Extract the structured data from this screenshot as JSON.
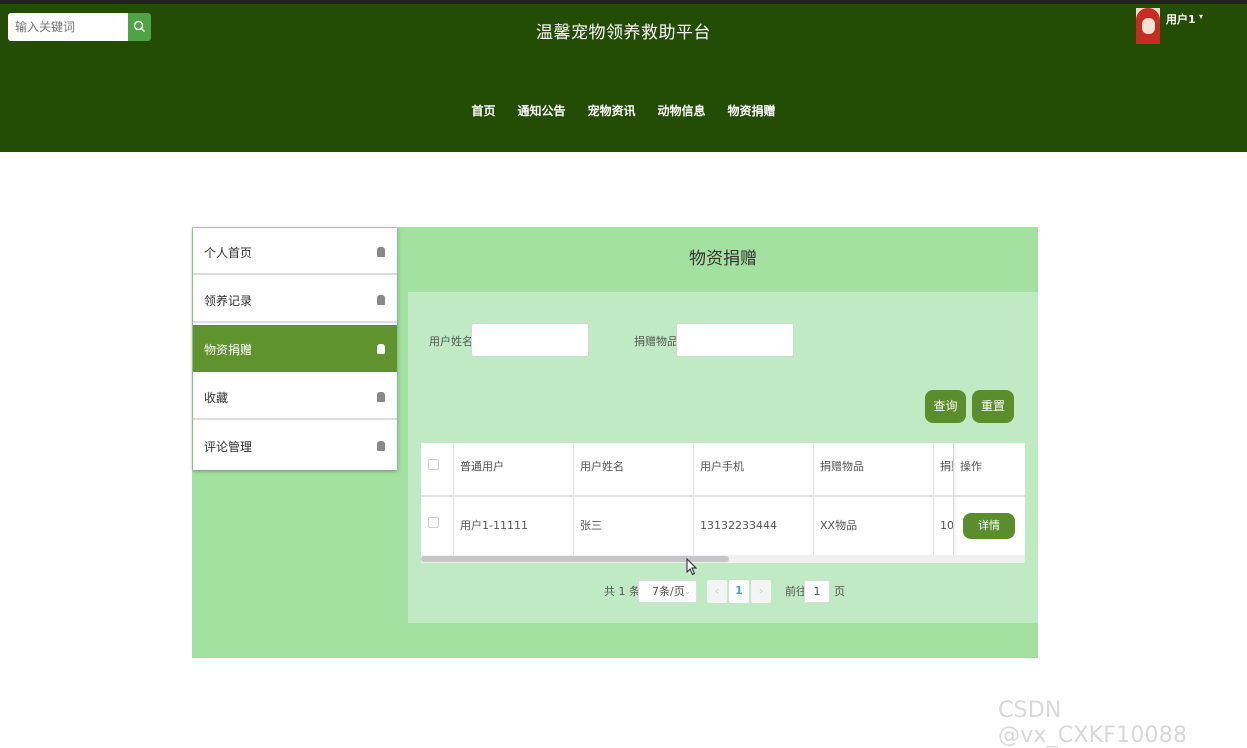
{
  "header": {
    "search_placeholder": "输入关键词",
    "search_icon": "search-icon",
    "site_title": "温馨宠物领养救助平台",
    "user_name": "用户1",
    "user_caret": "▾",
    "nav": [
      "首页",
      "通知公告",
      "宠物资讯",
      "动物信息",
      "物资捐赠"
    ]
  },
  "sidebar": {
    "items": [
      {
        "label": "个人首页",
        "icon": "user-icon"
      },
      {
        "label": "领养记录",
        "icon": "record-icon"
      },
      {
        "label": "物资捐赠",
        "icon": "donate-icon",
        "active": true
      },
      {
        "label": "收藏",
        "icon": "favorite-icon"
      },
      {
        "label": "评论管理",
        "icon": "comment-icon"
      }
    ]
  },
  "main": {
    "title": "物资捐赠",
    "filters": {
      "user_name_label": "用户姓名",
      "user_name_value": "",
      "item_label": "捐赠物品",
      "item_value": ""
    },
    "buttons": {
      "query": "查询",
      "reset": "重置"
    },
    "table": {
      "columns": [
        "普通用户",
        "用户姓名",
        "用户手机",
        "捐赠物品",
        "捐赠",
        "操作"
      ],
      "rows": [
        {
          "user": "用户1-11111",
          "name": "张三",
          "phone": "13132233444",
          "item": "XX物品",
          "qty": "10",
          "action": "详情"
        }
      ]
    },
    "pagination": {
      "total": "共 1 条",
      "page_size": "7条/页",
      "prev": "‹",
      "current": "1",
      "next": "›",
      "goto_label": "前往",
      "goto_value": "1",
      "page_unit": "页"
    }
  },
  "watermark": "CSDN @vx_CXKF10088",
  "colors": {
    "header": "#234d05",
    "panel": "#a3e1a0",
    "inner": "#c0eac3",
    "accent": "#5a8e2c",
    "search_button": "#4ea344"
  }
}
